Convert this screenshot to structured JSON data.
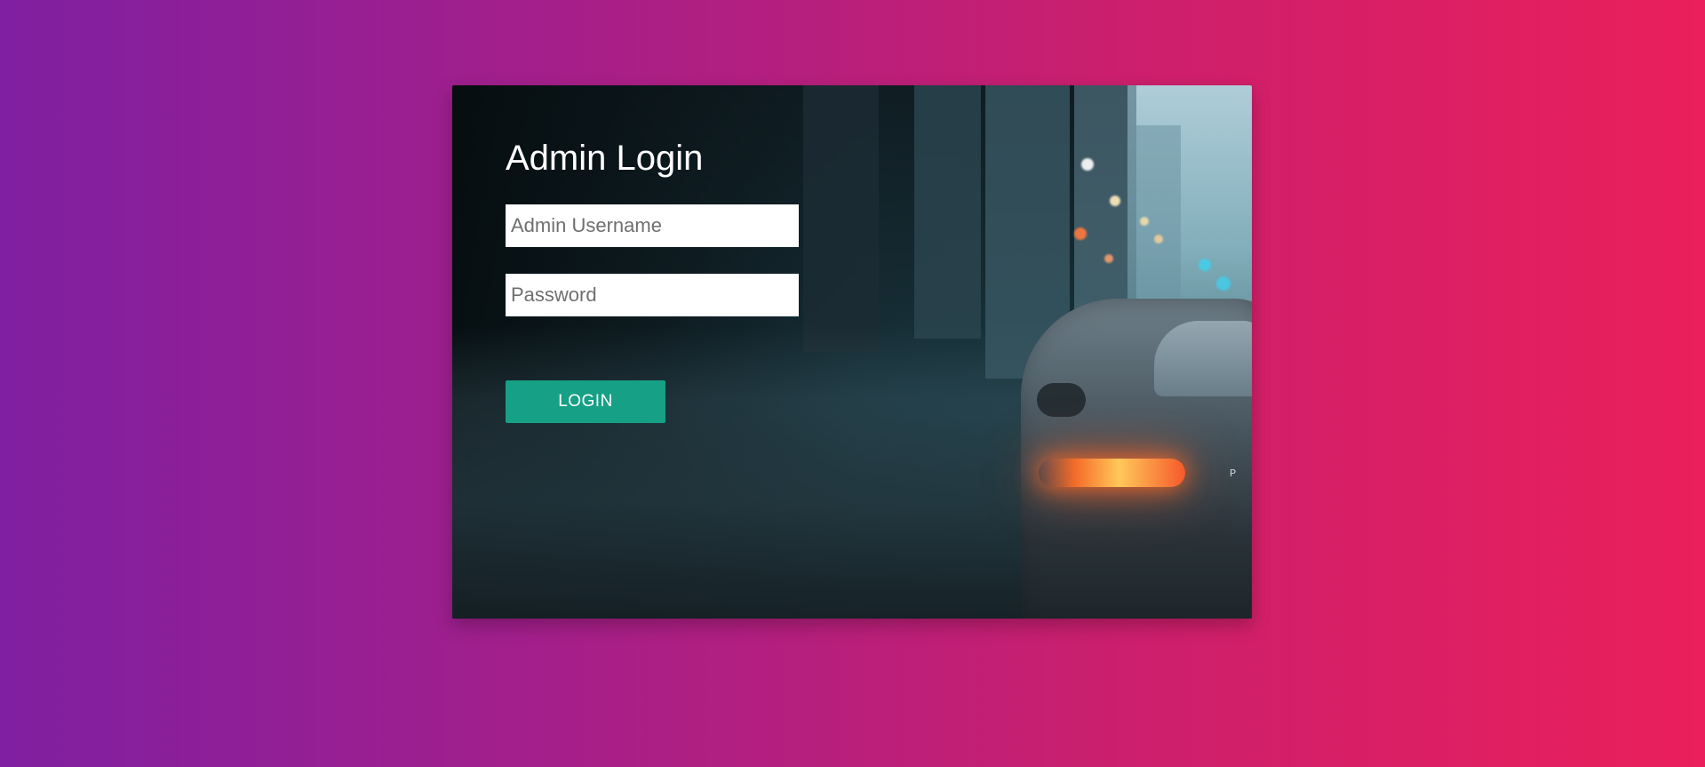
{
  "login_card": {
    "title": "Admin Login",
    "username": {
      "placeholder": "Admin Username",
      "value": ""
    },
    "password": {
      "placeholder": "Password",
      "value": ""
    },
    "submit_label": "LOGIN"
  },
  "background": {
    "car_badge_text": "P"
  },
  "colors": {
    "gradient_left": "#7f1fa1",
    "gradient_right": "#ea1f5b",
    "button": "#16a085"
  }
}
